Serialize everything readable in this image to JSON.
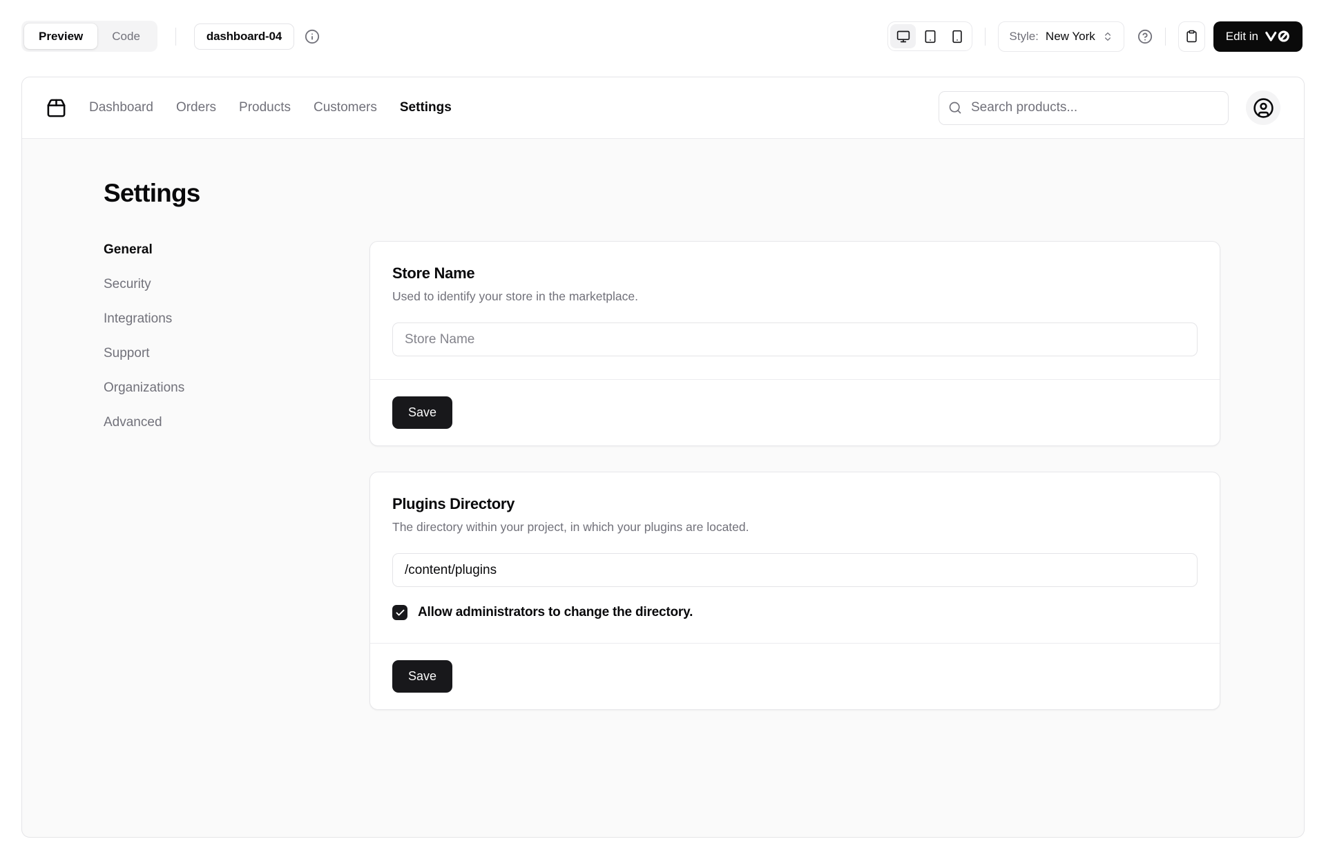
{
  "toolbar": {
    "view_tabs": [
      {
        "label": "Preview",
        "active": true
      },
      {
        "label": "Code",
        "active": false
      }
    ],
    "block_name": "dashboard-04",
    "style_label": "Style:",
    "style_value": "New York",
    "edit_in_v0_label": "Edit in",
    "edit_in_v0_logo": "v0"
  },
  "preview": {
    "nav": {
      "links": [
        {
          "label": "Dashboard",
          "active": false
        },
        {
          "label": "Orders",
          "active": false
        },
        {
          "label": "Products",
          "active": false
        },
        {
          "label": "Customers",
          "active": false
        },
        {
          "label": "Settings",
          "active": true
        }
      ],
      "search_placeholder": "Search products..."
    },
    "page": {
      "title": "Settings",
      "sidebar": [
        {
          "label": "General",
          "active": true
        },
        {
          "label": "Security",
          "active": false
        },
        {
          "label": "Integrations",
          "active": false
        },
        {
          "label": "Support",
          "active": false
        },
        {
          "label": "Organizations",
          "active": false
        },
        {
          "label": "Advanced",
          "active": false
        }
      ],
      "cards": [
        {
          "title": "Store Name",
          "description": "Used to identify your store in the marketplace.",
          "input_placeholder": "Store Name",
          "input_value": "",
          "save_label": "Save"
        },
        {
          "title": "Plugins Directory",
          "description": "The directory within your project, in which your plugins are located.",
          "input_value": "/content/plugins",
          "checkbox": {
            "checked": true,
            "label": "Allow administrators to change the directory."
          },
          "save_label": "Save"
        }
      ]
    }
  },
  "icons": {
    "brand": "package-icon",
    "devices": [
      "monitor",
      "tablet",
      "smartphone"
    ],
    "info": "circle-info",
    "help": "circle-help",
    "copy": "clipboard",
    "style_chevron": "chevrons-up-down",
    "search": "magnifier",
    "user": "circle-user",
    "checkbox_check": "checkmark"
  },
  "colors": {
    "accent_dark": "#18181b",
    "border": "#e4e4e7",
    "muted_text": "#71717a",
    "content_bg": "#fafafa",
    "card_bg": "#ffffff",
    "active_text": "#09090b"
  }
}
